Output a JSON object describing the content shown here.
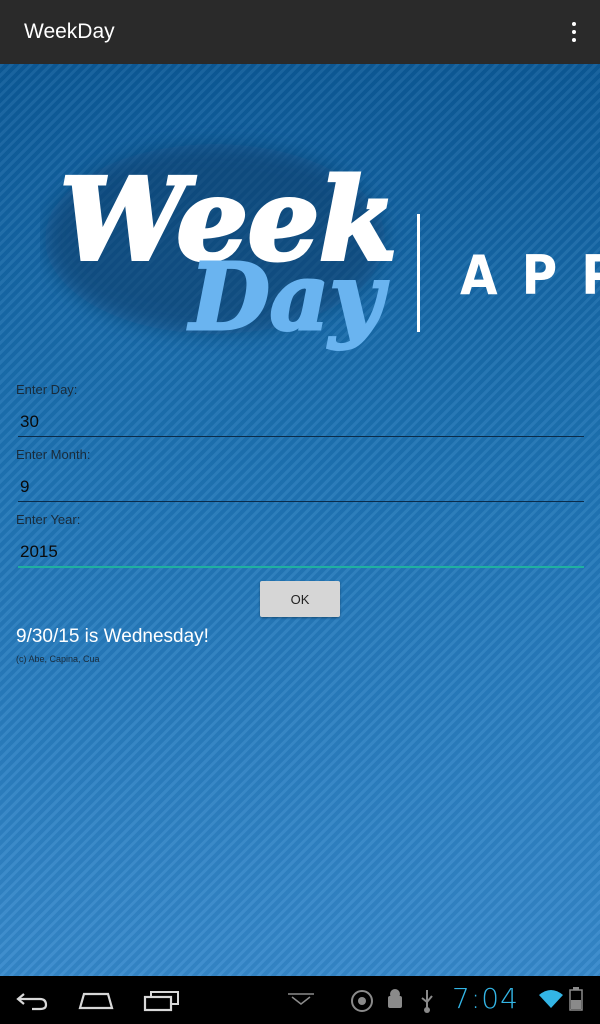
{
  "app": {
    "title": "WeekDay"
  },
  "logo": {
    "word1": "Week",
    "word2": "Day",
    "app_text": "APP"
  },
  "form": {
    "day_label": "Enter Day:",
    "day_value": "30",
    "month_label": "Enter Month:",
    "month_value": "9",
    "year_label": "Enter Year:",
    "year_value": "2015",
    "ok_label": "OK"
  },
  "result": {
    "text": "9/30/15 is Wednesday!",
    "credit": "(c) Abe, Capina, Cua"
  },
  "system": {
    "clock": "7:04"
  },
  "colors": {
    "accent": "#33b5e5",
    "field_focus": "#1fb0a0",
    "logo_blue": "#6ab4f0"
  }
}
